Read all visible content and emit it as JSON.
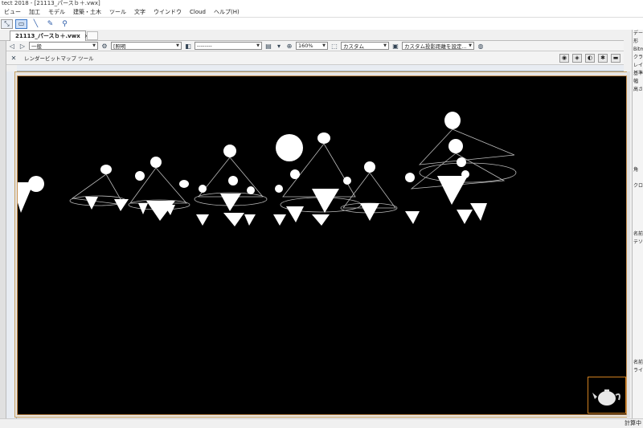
{
  "window": {
    "title": "tect 2018 - [21113_パースｂ＋.vwx]"
  },
  "menu": [
    "ビュー",
    "加工",
    "モデル",
    "建築・土木",
    "ツール",
    "文字",
    "ウインドウ",
    "Cloud",
    "ヘルプ(H)"
  ],
  "tools": [
    {
      "icon": "select-arrow-icon"
    },
    {
      "icon": "rectangle-select-icon"
    },
    {
      "icon": "line-tool-icon"
    },
    {
      "icon": "pencil-icon"
    },
    {
      "icon": "magnify-icon"
    }
  ],
  "document_tab": {
    "label": "21113_パースｂ＋.vwx",
    "close": "×"
  },
  "view_bar": {
    "class_select": "一般",
    "layer_select": "[照明",
    "line_select": "--------",
    "zoom": "160%",
    "view_select": "カスタム",
    "projection_select": "カスタム投影距離を設定..."
  },
  "snap_bar": {
    "label": "レンダービットマップ ツール"
  },
  "right_panel": [
    "デー",
    "形",
    "Bitm",
    "クラ",
    "レイ",
    "基準",
    "幅",
    "高さ",
    "角",
    "クロ",
    "名前",
    "テソ",
    "名前",
    "ライ"
  ],
  "status": {
    "text": "計算中"
  },
  "colors": {
    "canvas": "#000000",
    "accent": "#d08020",
    "tool_active": "#3c78c8"
  }
}
